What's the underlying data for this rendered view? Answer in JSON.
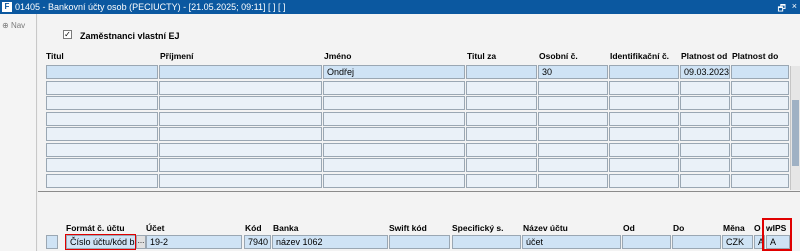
{
  "window": {
    "title": "01405 - Bankovní účty osob (PECIUCTY) - [21.05.2025; 09:11]  [ ]  [ ]",
    "logo": "F",
    "restore_icon": "🗗",
    "close_icon": "×"
  },
  "sidebar": {
    "nav_label": "Nav",
    "nav_icon": "⊕"
  },
  "filter": {
    "checkbox_mark": "✓",
    "label": "Zaměstnanci vlastní EJ"
  },
  "persons": {
    "headers": [
      "Titul",
      "Příjmení",
      "Jméno",
      "Titul za",
      "Osobní č.",
      "Identifikační č.",
      "Platnost od",
      "Platnost do"
    ],
    "rows": [
      [
        "",
        "",
        "Ondřej",
        "",
        "30",
        "",
        "09.03.2023",
        ""
      ],
      [
        "",
        "",
        "",
        "",
        "",
        "",
        "",
        ""
      ],
      [
        "",
        "",
        "",
        "",
        "",
        "",
        "",
        ""
      ],
      [
        "",
        "",
        "",
        "",
        "",
        "",
        "",
        ""
      ],
      [
        "",
        "",
        "",
        "",
        "",
        "",
        "",
        ""
      ],
      [
        "",
        "",
        "",
        "",
        "",
        "",
        "",
        ""
      ],
      [
        "",
        "",
        "",
        "",
        "",
        "",
        "",
        ""
      ],
      [
        "",
        "",
        "",
        "",
        "",
        "",
        "",
        ""
      ]
    ]
  },
  "accounts": {
    "headers": [
      "Formát č. účtu",
      "Účet",
      "Kód",
      "Banka",
      "Swift kód",
      "Specifický s.",
      "Název účtu",
      "Od",
      "Do",
      "Měna",
      "O",
      "wIPS"
    ],
    "row": {
      "format": "Číslo účtu/kód ba",
      "lov": "...",
      "ucet": "19-2",
      "kod": "7940",
      "banka": "název 1062",
      "swift": "",
      "spec": "",
      "nazev": "účet",
      "od": "",
      "do": "",
      "mena": "CZK",
      "o": "A",
      "wips": "A"
    }
  }
}
